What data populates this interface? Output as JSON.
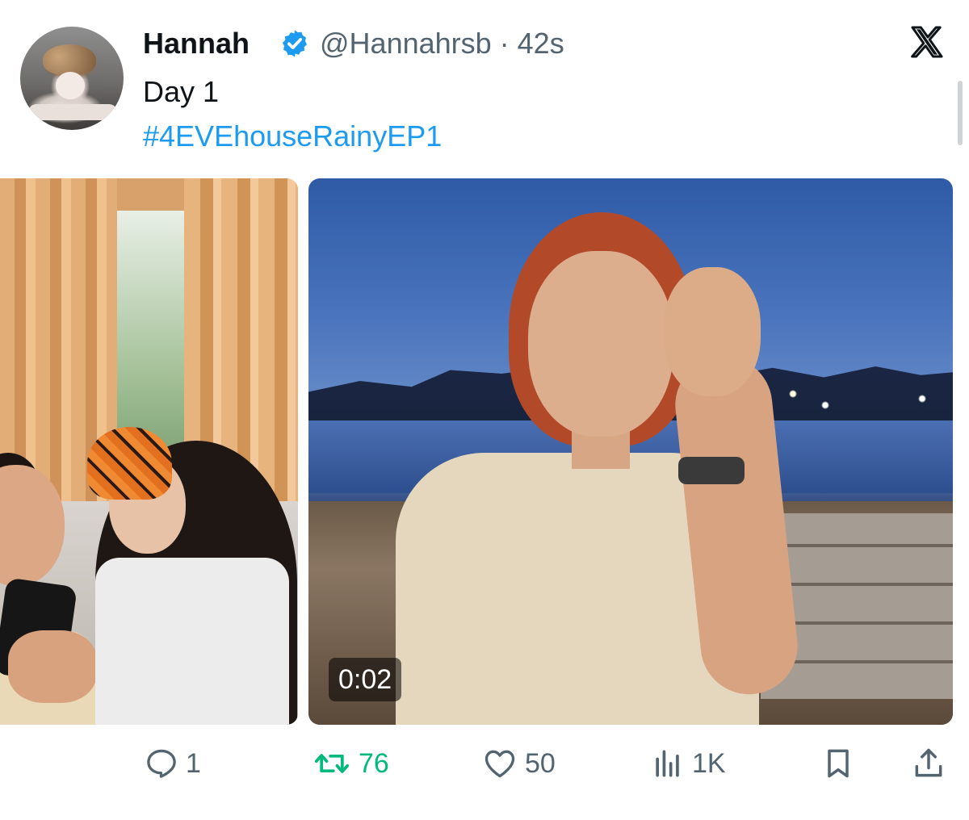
{
  "tweet": {
    "author_name": "Hannah",
    "handle_time": "@Hannahrsb · 42s",
    "text": "Day 1",
    "hashtag": "#4EVEhouseRainyEP1"
  },
  "media": {
    "video_duration": "0:02"
  },
  "actions": {
    "replies": "1",
    "retweets": "76",
    "likes": "50",
    "views": "1K"
  },
  "icons": [
    "verified-icon",
    "x-logo-icon",
    "reply-icon",
    "retweet-icon",
    "like-icon",
    "views-icon",
    "bookmark-icon",
    "share-icon"
  ],
  "colors": {
    "link": "#1d9bf0",
    "muted": "#536471",
    "retweet": "#00ba7c",
    "verified": "#1d9bf0"
  }
}
